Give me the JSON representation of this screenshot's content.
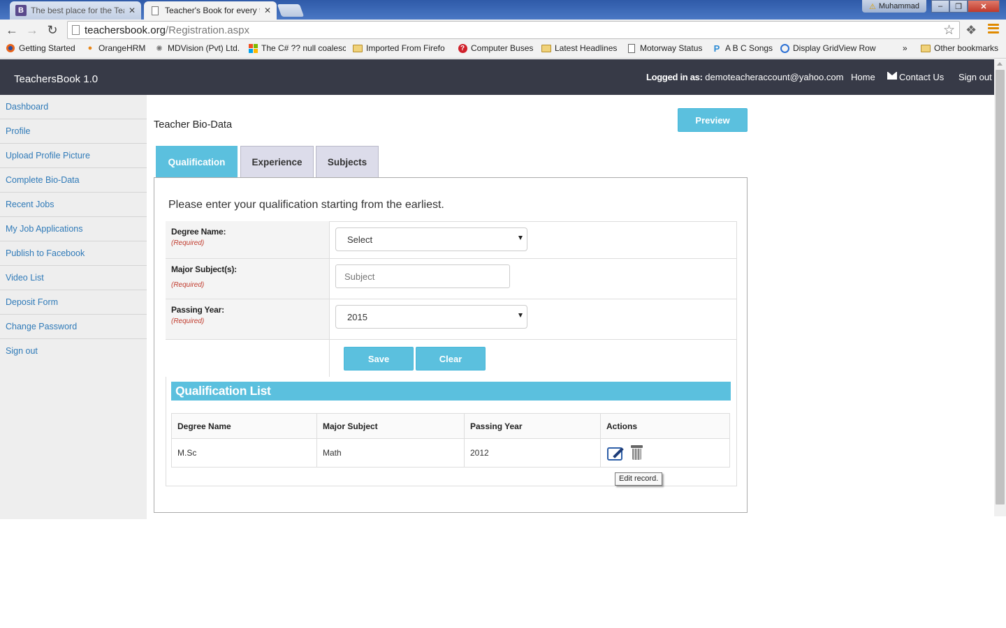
{
  "browser": {
    "tabs": [
      {
        "title": "The best place for the Tea",
        "favicon": "B",
        "active": false
      },
      {
        "title": "Teacher's Book for every t",
        "favicon": "page-icon",
        "active": true
      }
    ],
    "user_badge": "Muhammad",
    "url_host": "teachersbook.org",
    "url_path": "/Registration.aspx",
    "bookmarks": [
      {
        "label": "Getting Started",
        "icon": "firefox-icon"
      },
      {
        "label": "OrangeHRM",
        "icon": "orange-icon"
      },
      {
        "label": "MDVision (Pvt) Ltd.",
        "icon": "mdvision-icon"
      },
      {
        "label": "The C# ?? null coalesc",
        "icon": "windows-icon"
      },
      {
        "label": "Imported From Firefo",
        "icon": "folder-icon"
      },
      {
        "label": "Computer Buses",
        "icon": "question-icon"
      },
      {
        "label": "Latest Headlines",
        "icon": "folder-icon"
      },
      {
        "label": "Motorway Status",
        "icon": "document-icon"
      },
      {
        "label": "A B C Songs",
        "icon": "p-icon"
      },
      {
        "label": "Display GridView Row",
        "icon": "asp-icon"
      }
    ],
    "overflow_chevron": "»",
    "other_bookmarks": "Other bookmarks"
  },
  "app": {
    "brand": "TeachersBook 1.0",
    "logged_in_label": "Logged in as:",
    "logged_in_user": "demoteacheraccount@yahoo.com",
    "nav": {
      "home": "Home",
      "contact": "Contact Us",
      "signout": "Sign out"
    }
  },
  "sidebar": {
    "items": [
      {
        "label": "Dashboard"
      },
      {
        "label": "Profile"
      },
      {
        "label": "Upload Profile Picture"
      },
      {
        "label": "Complete Bio-Data"
      },
      {
        "label": "Recent Jobs"
      },
      {
        "label": "My Job Applications"
      },
      {
        "label": "Publish to Facebook"
      },
      {
        "label": "Video List"
      },
      {
        "label": "Deposit Form"
      },
      {
        "label": "Change Password"
      },
      {
        "label": "Sign out"
      }
    ]
  },
  "main": {
    "title": "Teacher Bio-Data",
    "preview_label": "Preview",
    "tabs": [
      {
        "label": "Qualification",
        "active": true
      },
      {
        "label": "Experience",
        "active": false
      },
      {
        "label": "Subjects",
        "active": false
      }
    ],
    "intro": "Please enter your qualification starting from the earliest.",
    "form": {
      "degree_label": "Degree Name:",
      "degree_value": "Select",
      "major_label": "Major Subject(s):",
      "major_placeholder": "Subject",
      "year_label": "Passing Year:",
      "year_value": "2015",
      "required": "(Required)",
      "save_label": "Save",
      "clear_label": "Clear"
    },
    "list": {
      "title": "Qualification List",
      "columns": [
        "Degree Name",
        "Major Subject",
        "Passing Year",
        "Actions"
      ],
      "rows": [
        {
          "degree": "M.Sc",
          "major": "Math",
          "year": "2012"
        }
      ]
    },
    "tooltip": "Edit record."
  },
  "colors": {
    "accent": "#5bc0de",
    "topbar": "#373a47",
    "link": "#2f7ab8",
    "required": "#c0392b"
  }
}
